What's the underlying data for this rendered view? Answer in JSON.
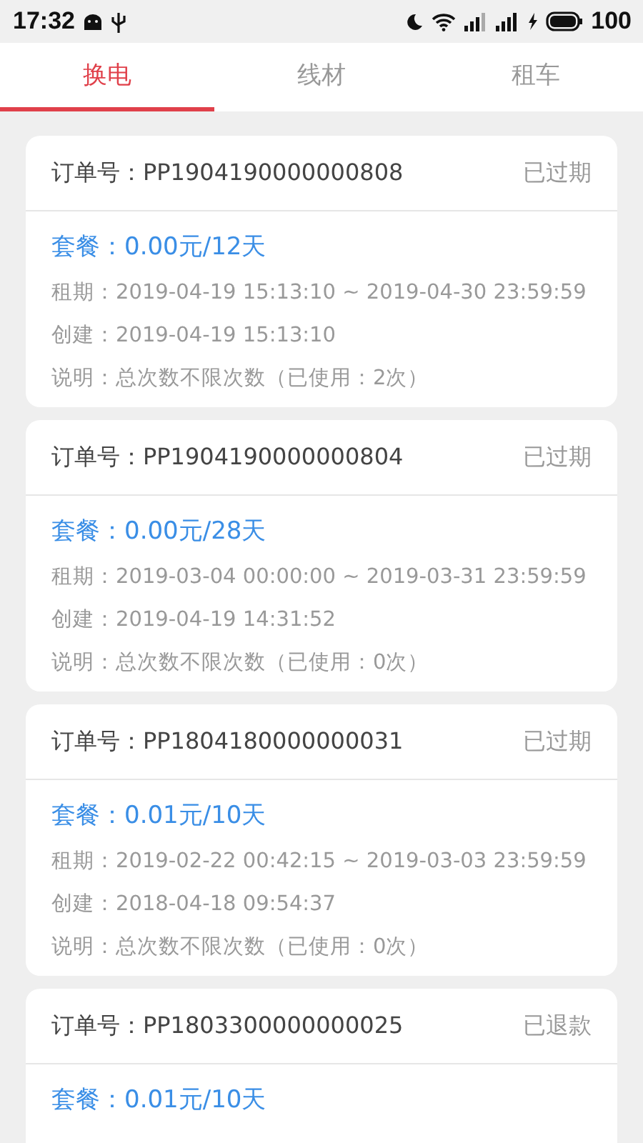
{
  "status_bar": {
    "time": "17:32",
    "battery": "100"
  },
  "tabs": [
    {
      "label": "换电",
      "selected": true
    },
    {
      "label": "线材",
      "selected": false
    },
    {
      "label": "租车",
      "selected": false
    }
  ],
  "orders": [
    {
      "order_no": "订单号：PP1904190000000808",
      "status": "已过期",
      "package": "套餐：0.00元/12天",
      "details": [
        "租期：2019-04-19 15:13:10 ~ 2019-04-30 23:59:59",
        "创建：2019-04-19 15:13:10",
        "说明：总次数不限次数（已使用：2次）"
      ]
    },
    {
      "order_no": "订单号：PP1904190000000804",
      "status": "已过期",
      "package": "套餐：0.00元/28天",
      "details": [
        "租期：2019-03-04 00:00:00 ~ 2019-03-31 23:59:59",
        "创建：2019-04-19 14:31:52",
        "说明：总次数不限次数（已使用：0次）"
      ]
    },
    {
      "order_no": "订单号：PP1804180000000031",
      "status": "已过期",
      "package": "套餐：0.01元/10天",
      "details": [
        "租期：2019-02-22 00:42:15 ~ 2019-03-03 23:59:59",
        "创建：2018-04-18 09:54:37",
        "说明：总次数不限次数（已使用：0次）"
      ]
    },
    {
      "order_no": "订单号：PP1803300000000025",
      "status": "已退款",
      "package": "套餐：0.01元/10天"
    }
  ]
}
